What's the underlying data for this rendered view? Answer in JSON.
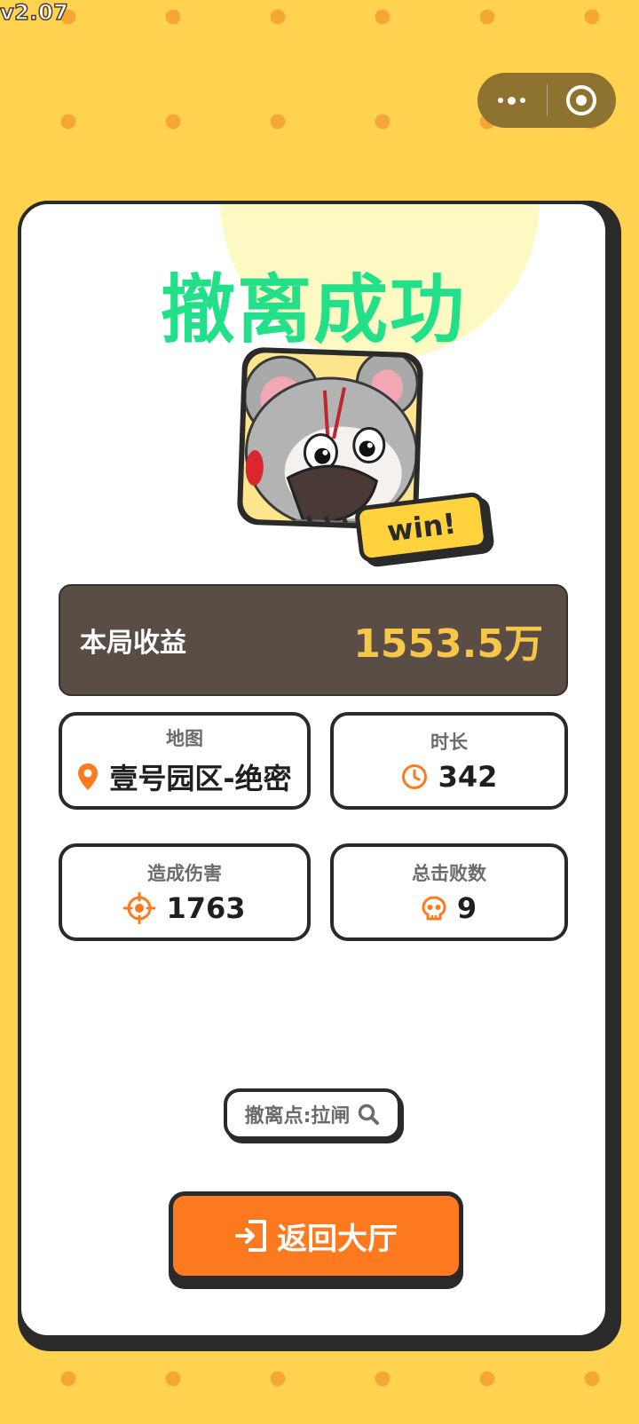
{
  "app": {
    "version": "v2.07"
  },
  "result": {
    "title": "撤离成功",
    "badge": "win!"
  },
  "earnings": {
    "label": "本局收益",
    "value": "1553.5万"
  },
  "stats": [
    {
      "label": "地图",
      "value": "壹号园区-绝密",
      "icon": "location-pin-icon"
    },
    {
      "label": "时长",
      "value": "342",
      "icon": "clock-icon"
    },
    {
      "label": "造成伤害",
      "value": "1763",
      "icon": "crosshair-icon"
    },
    {
      "label": "总击败数",
      "value": "9",
      "icon": "skull-icon"
    }
  ],
  "extraction": {
    "label": "撤离点:拉闸"
  },
  "actions": {
    "return_label": "返回大厅"
  },
  "colors": {
    "background": "#ffd24f",
    "dots": "#f4a636",
    "title": "#22e08a",
    "accent_orange": "#ff7a1f",
    "earnings_bg": "#5a4d45",
    "earnings_value": "#f9c747"
  }
}
